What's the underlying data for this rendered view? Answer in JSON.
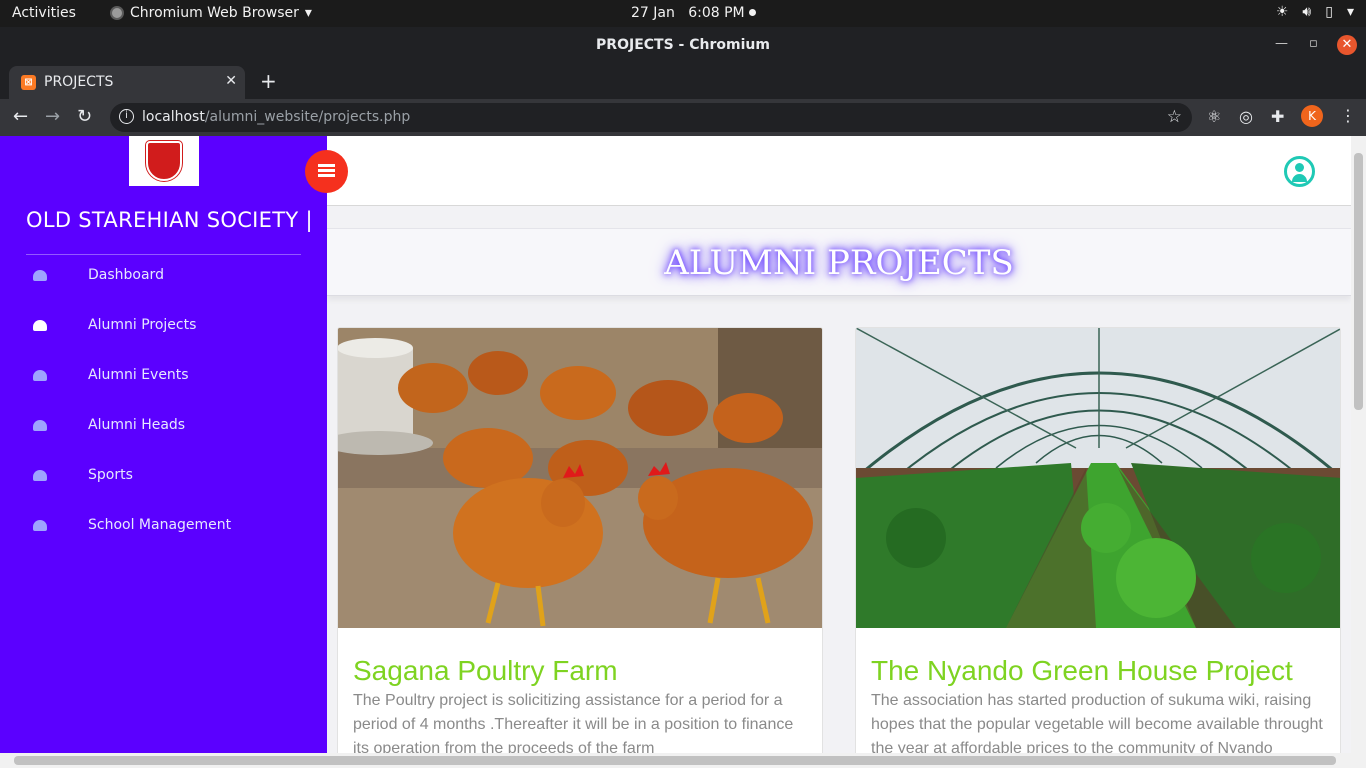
{
  "os_bar": {
    "activities": "Activities",
    "app_name": "Chromium Web Browser",
    "date": "27 Jan",
    "time": "6:08 PM"
  },
  "window": {
    "title": "PROJECTS - Chromium"
  },
  "browser": {
    "tab_title": "PROJECTS",
    "favicon_letter": "⊠",
    "url_host": "localhost",
    "url_path": "/alumni_website/projects.php",
    "profile_initial": "K"
  },
  "sidebar": {
    "brand": "OLD STAREHIAN SOCIETY |",
    "items": [
      {
        "label": "Dashboard",
        "icon": "tachometer-icon",
        "active": false
      },
      {
        "label": "Alumni Projects",
        "icon": "tachometer-icon",
        "active": true
      },
      {
        "label": "Alumni Events",
        "icon": "tachometer-icon",
        "active": false
      },
      {
        "label": "Alumni Heads",
        "icon": "tachometer-icon",
        "active": false
      },
      {
        "label": "Sports",
        "icon": "tachometer-icon",
        "active": false
      },
      {
        "label": "School Management",
        "icon": "tachometer-icon",
        "active": false
      }
    ]
  },
  "page": {
    "heading": "ALUMNI PROJECTS"
  },
  "projects": [
    {
      "title": "Sagana Poultry Farm",
      "description": "The Poultry project is solicitizing assistance for a period for a period of 4 months .Thereafter it will be in a position to finance its operation from the proceeds of the farm",
      "image": "chickens-photo"
    },
    {
      "title": "The Nyando Green House Project",
      "description": "The association has started production of sukuma wiki, raising hopes that the popular vegetable will become available throught the year at affordable prices to the community of Nyando",
      "image": "greenhouse-photo"
    }
  ],
  "colors": {
    "sidebar_bg": "#5b00ff",
    "toggle_button": "#f5301e",
    "project_title": "#7ed321",
    "user_icon": "#1fc9b5"
  }
}
